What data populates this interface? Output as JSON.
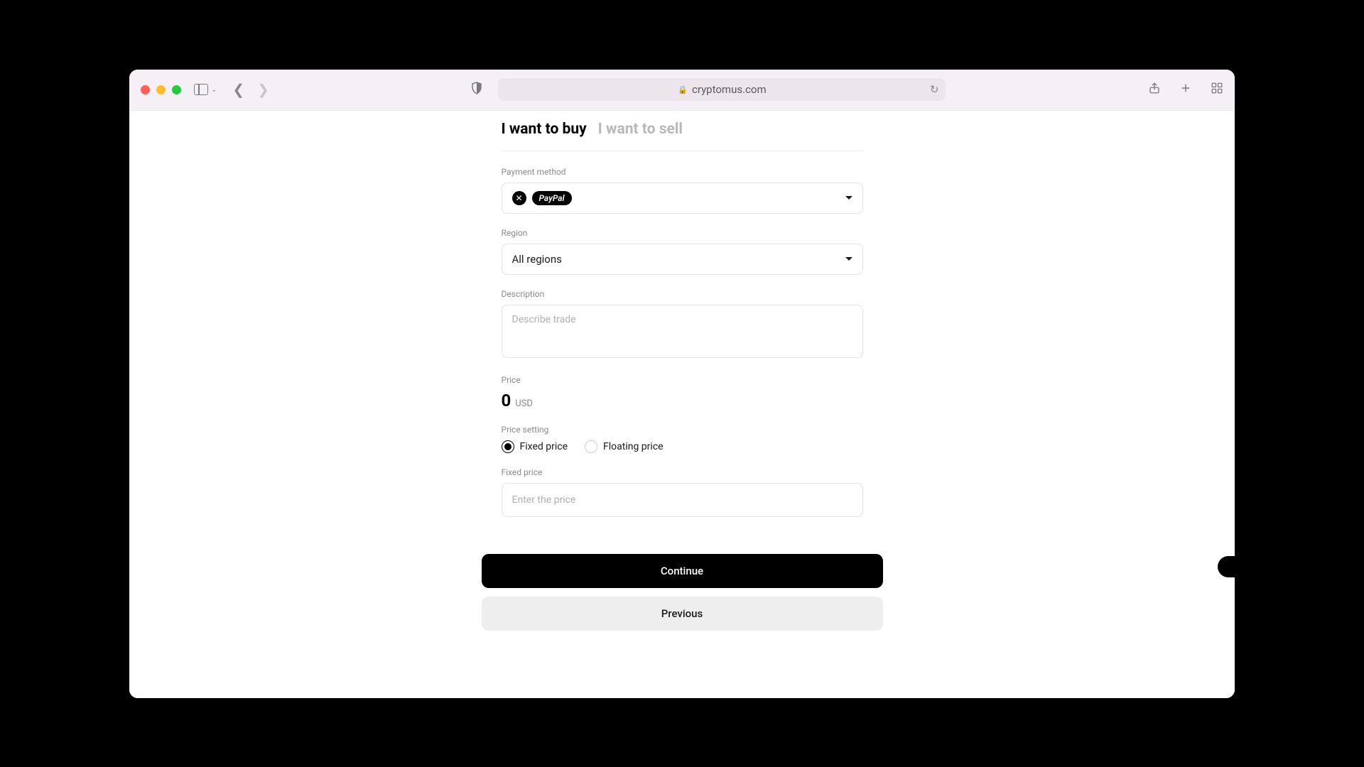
{
  "browser": {
    "url": "cryptomus.com"
  },
  "tabs": {
    "buy": "I want to buy",
    "sell": "I want to sell",
    "active": "buy"
  },
  "form": {
    "payment_method": {
      "label": "Payment method",
      "chips": [
        "PayPal"
      ]
    },
    "region": {
      "label": "Region",
      "value": "All regions"
    },
    "description": {
      "label": "Description",
      "placeholder": "Describe trade"
    },
    "price": {
      "label": "Price",
      "value": "0",
      "currency": "USD"
    },
    "price_setting": {
      "label": "Price setting",
      "options": {
        "fixed": "Fixed price",
        "floating": "Floating price"
      },
      "selected": "fixed"
    },
    "fixed_price": {
      "label": "Fixed price",
      "placeholder": "Enter the price"
    }
  },
  "actions": {
    "continue": "Continue",
    "previous": "Previous"
  }
}
